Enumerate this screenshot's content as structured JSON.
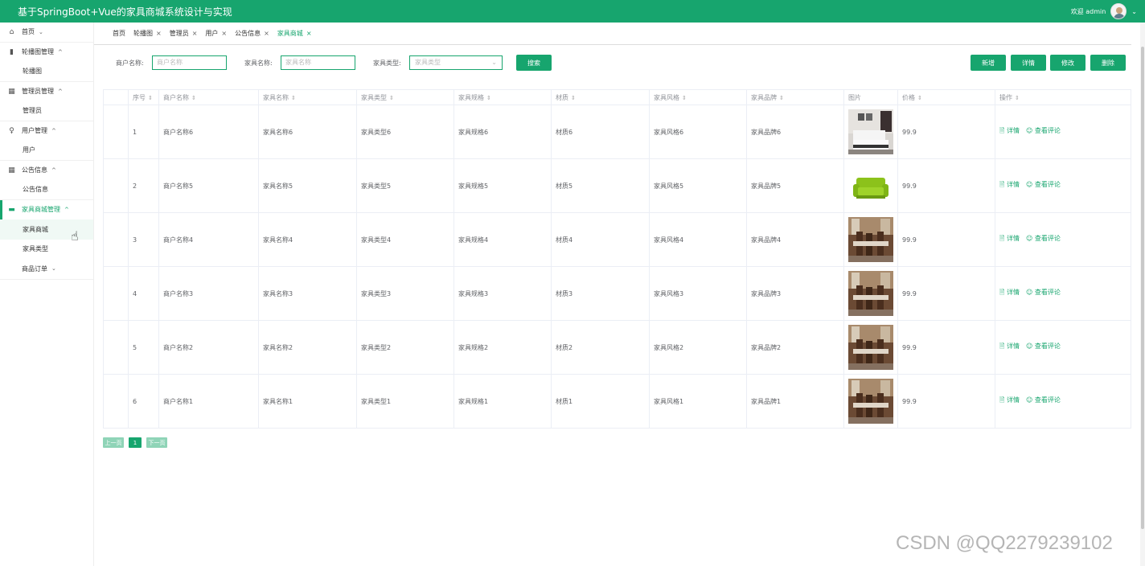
{
  "header": {
    "title": "基于SpringBoot+Vue的家具商城系统设计与实现",
    "welcome": "欢迎 admin",
    "colors": {
      "primary": "#17a56e"
    }
  },
  "sidebar": {
    "home": "首页",
    "groups": [
      {
        "label": "轮播图管理",
        "sub": "轮播图"
      },
      {
        "label": "管理员管理",
        "sub": "管理员"
      },
      {
        "label": "用户管理",
        "sub": "用户"
      },
      {
        "label": "公告信息",
        "sub": "公告信息"
      },
      {
        "label": "家具商城管理",
        "subs": [
          "家具商城",
          "家具类型"
        ]
      }
    ],
    "orders": "商品订单"
  },
  "tabs": [
    {
      "label": "首页"
    },
    {
      "label": "轮播图"
    },
    {
      "label": "管理员"
    },
    {
      "label": "用户"
    },
    {
      "label": "公告信息"
    },
    {
      "label": "家具商城"
    }
  ],
  "filters": {
    "merchant_label": "商户名称:",
    "merchant_placeholder": "商户名称",
    "name_label": "家具名称:",
    "name_placeholder": "家具名称",
    "type_label": "家具类型:",
    "type_placeholder": "家具类型",
    "search_button": "搜索"
  },
  "actions": {
    "add": "新增",
    "detail": "详情",
    "edit": "修改",
    "delete": "删除"
  },
  "table": {
    "headers": [
      "序号",
      "商户名称",
      "家具名称",
      "家具类型",
      "家具规格",
      "材质",
      "家具风格",
      "家具品牌",
      "图片",
      "价格",
      "操作"
    ],
    "op_detail": "详情",
    "op_comments": "查看评论",
    "rows": [
      {
        "no": "1",
        "merchant": "商户名称6",
        "name": "家具名称6",
        "type": "家具类型6",
        "spec": "家具规格6",
        "material": "材质6",
        "style": "家具风格6",
        "brand": "家具品牌6",
        "image": "bedroom",
        "price": "99.9"
      },
      {
        "no": "2",
        "merchant": "商户名称5",
        "name": "家具名称5",
        "type": "家具类型5",
        "spec": "家具规格5",
        "material": "材质5",
        "style": "家具风格5",
        "brand": "家具品牌5",
        "image": "sofa",
        "price": "99.9"
      },
      {
        "no": "3",
        "merchant": "商户名称4",
        "name": "家具名称4",
        "type": "家具类型4",
        "spec": "家具规格4",
        "material": "材质4",
        "style": "家具风格4",
        "brand": "家具品牌4",
        "image": "dining",
        "price": "99.9"
      },
      {
        "no": "4",
        "merchant": "商户名称3",
        "name": "家具名称3",
        "type": "家具类型3",
        "spec": "家具规格3",
        "material": "材质3",
        "style": "家具风格3",
        "brand": "家具品牌3",
        "image": "dining",
        "price": "99.9"
      },
      {
        "no": "5",
        "merchant": "商户名称2",
        "name": "家具名称2",
        "type": "家具类型2",
        "spec": "家具规格2",
        "material": "材质2",
        "style": "家具风格2",
        "brand": "家具品牌2",
        "image": "dining",
        "price": "99.9"
      },
      {
        "no": "6",
        "merchant": "商户名称1",
        "name": "家具名称1",
        "type": "家具类型1",
        "spec": "家具规格1",
        "material": "材质1",
        "style": "家具风格1",
        "brand": "家具品牌1",
        "image": "dining",
        "price": "99.9"
      }
    ]
  },
  "pagination": {
    "prev": "上一页",
    "current": "1",
    "next": "下一页"
  },
  "watermark": "CSDN @QQ2279239102"
}
